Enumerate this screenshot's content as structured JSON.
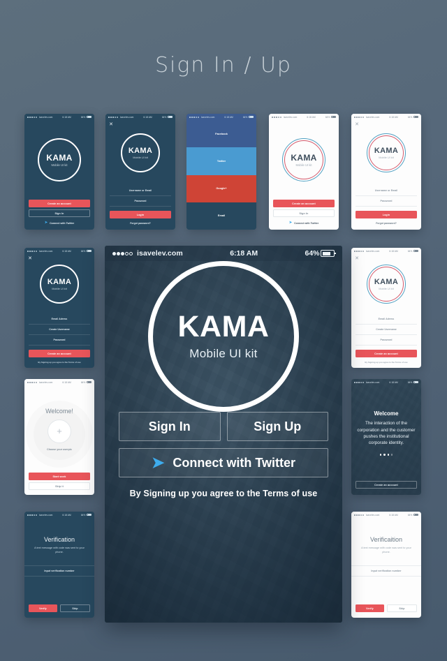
{
  "page": {
    "title": "Sign In / Up",
    "background_color": "#55677a",
    "accent_red": "#e8555a",
    "accent_twitter": "#3eaced"
  },
  "status_bar": {
    "carrier": "isavelev.com",
    "time": "6:18 AM",
    "battery": "64%",
    "signal_filled": 3,
    "signal_empty": 2
  },
  "logo": {
    "name": "KAMA",
    "subtitle": "Mobile UI kit"
  },
  "main_screen": {
    "sign_in": "Sign In",
    "sign_up": "Sign Up",
    "twitter": "Connect with Twitter",
    "terms": "By Signing up you agree to the Terms of use",
    "twitter_icon": "twitter-bird-icon"
  },
  "screens": {
    "dark_welcome": {
      "create_account": "Create an account",
      "sign_in": "Sign In",
      "twitter": "Connect with Twitter"
    },
    "dark_login": {
      "close": "✕",
      "username": "Username or Email",
      "password": "Password",
      "login": "Login",
      "forgot": "Forgot password?"
    },
    "social": {
      "items": [
        {
          "label": "Facebook",
          "color": "#3c5c92"
        },
        {
          "label": "Twitter",
          "color": "#4a9bd1"
        },
        {
          "label": "Google+",
          "color": "#cf4436"
        },
        {
          "label": "Email",
          "color": "#27485e"
        }
      ]
    },
    "light_welcome": {
      "create_account": "Create an account",
      "sign_in": "Sign In",
      "twitter": "Connect with Twitter"
    },
    "light_login": {
      "close": "✕",
      "username": "Username or Email",
      "password": "Password",
      "login": "Login",
      "forgot": "Forgot password?"
    },
    "dark_signup": {
      "close": "✕",
      "email": "Email Adress",
      "username": "Create Username",
      "password": "Password",
      "create_account": "Create an account",
      "terms": "By Signing up you agree to the Terms of use"
    },
    "light_signup": {
      "close": "✕",
      "email": "Email Adress",
      "username": "Create Username",
      "password": "Password",
      "create_account": "Create an account",
      "terms": "By Signing up you agree to the Terms of use"
    },
    "userpic": {
      "title": "Welcome!",
      "plus": "+",
      "hint": "Choose your userpic",
      "start": "Start work",
      "skip": "Skip it"
    },
    "onboarding": {
      "title": "Welcome",
      "body": "The interaction of the corporation and the customer pushes the institutional corporate identity.",
      "dots": 4,
      "active_dot": 3,
      "create_account": "Create an account"
    },
    "dark_verification": {
      "title": "Verification",
      "body": "A text message with code was sent to your phone.",
      "input": "Input verification number",
      "verify": "Verify",
      "skip": "Skip"
    },
    "light_verification": {
      "title": "Verificaition",
      "body": "A text message with code was sent to your phone.",
      "input": "Input verification number",
      "verify": "Verify",
      "skip": "Skip"
    }
  }
}
